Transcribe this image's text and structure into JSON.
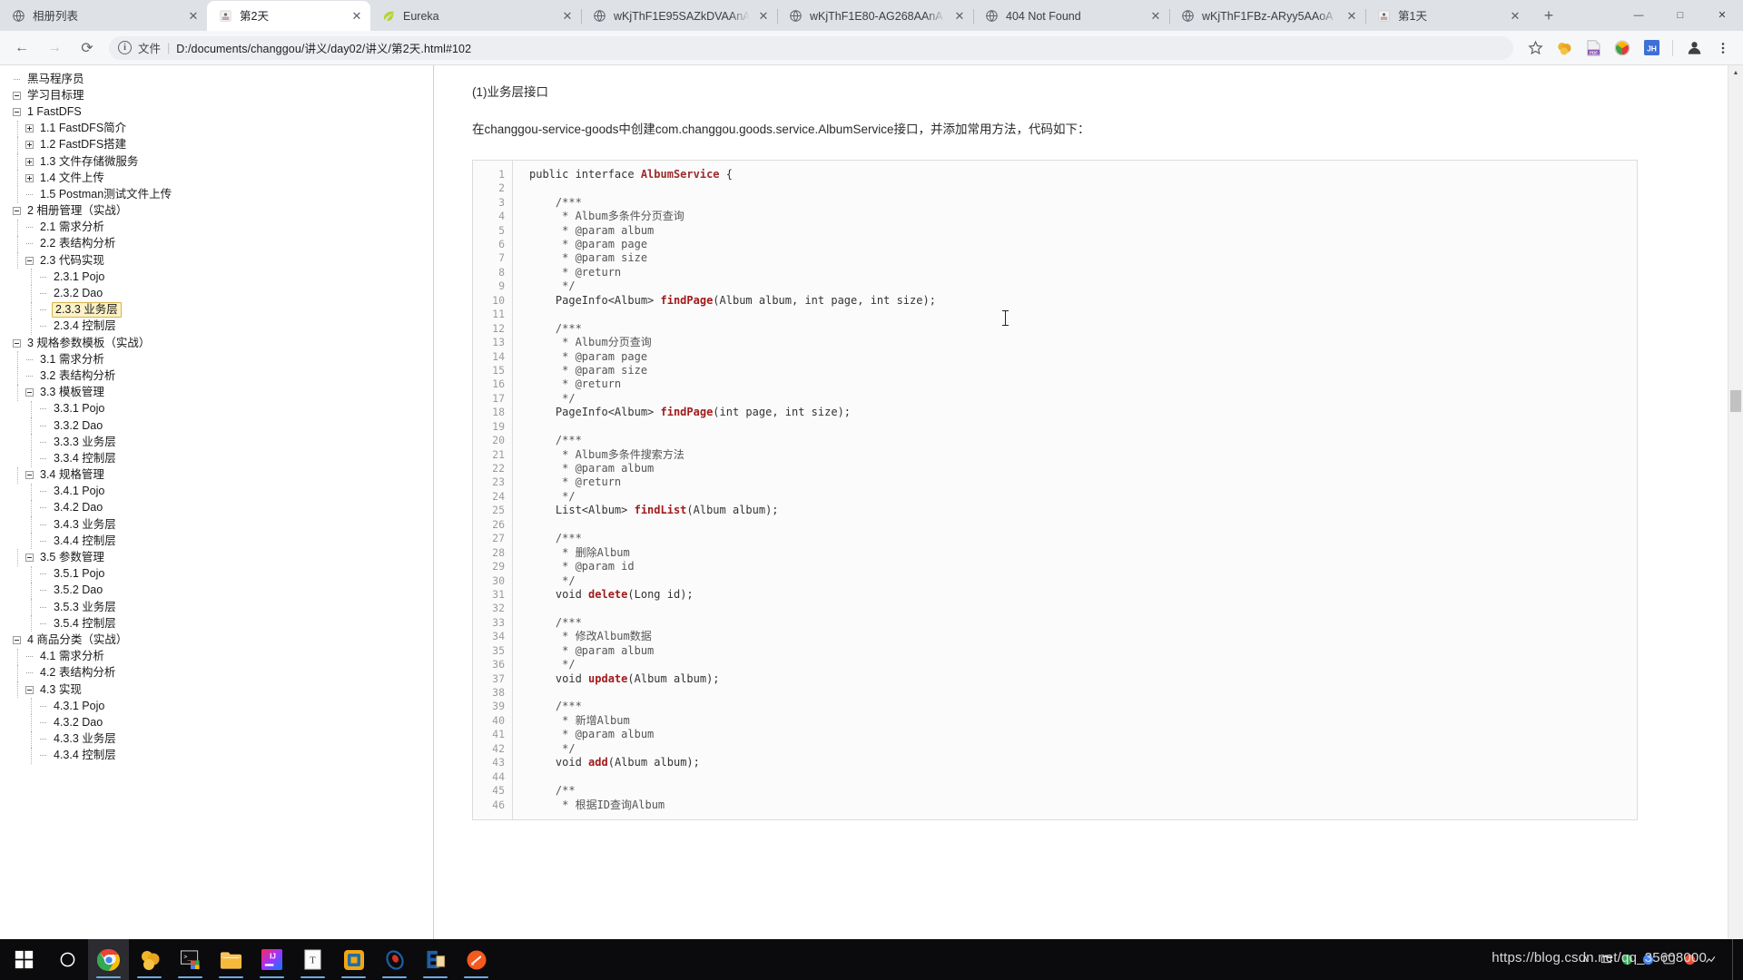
{
  "browser": {
    "tabs": [
      {
        "title": "相册列表",
        "icon": "globe-icon",
        "active": false
      },
      {
        "title": "第2天",
        "icon": "doc-icon",
        "active": true
      },
      {
        "title": "Eureka",
        "icon": "leaf-icon",
        "active": false
      },
      {
        "title": "wKjThF1E95SAZkDVAAnA",
        "icon": "globe-icon",
        "active": false
      },
      {
        "title": "wKjThF1E80-AG268AAnA",
        "icon": "globe-icon",
        "active": false
      },
      {
        "title": "404 Not Found",
        "icon": "globe-icon",
        "active": false
      },
      {
        "title": "wKjThF1FBz-ARyy5AAoA",
        "icon": "globe-icon",
        "active": false
      },
      {
        "title": "第1天",
        "icon": "doc-icon",
        "active": false
      }
    ],
    "new_tab_label": "+",
    "window_controls": {
      "minimize": "—",
      "maximize": "□",
      "close": "✕"
    },
    "close_label": "✕",
    "nav": {
      "back": "←",
      "forward": "→",
      "reload": "⟳"
    },
    "omnibox": {
      "info_glyph": "i",
      "scheme_label": "文件",
      "separator": "|",
      "url": "D:/documents/changgou/讲义/day02/讲义/第2天.html#102"
    },
    "toolbar_icons": [
      {
        "name": "bookmark-star-icon",
        "glyph": "☆"
      },
      {
        "name": "extension-honey-icon",
        "glyph": "●"
      },
      {
        "name": "pdf-extension-icon",
        "glyph": "PDF"
      },
      {
        "name": "yandex-extension-icon",
        "glyph": "①"
      },
      {
        "name": "jh-extension-icon",
        "glyph": "JH"
      },
      {
        "name": "profile-avatar-icon",
        "glyph": "●"
      },
      {
        "name": "chrome-menu-icon",
        "glyph": "⋮"
      }
    ]
  },
  "toc": {
    "items": [
      {
        "level": 0,
        "toggle": "none",
        "label": "黑马程序员",
        "highlight": false
      },
      {
        "level": 0,
        "toggle": "minus",
        "label": "学习目标理",
        "highlight": false
      },
      {
        "level": 1,
        "toggle": "minus",
        "label": "1 FastDFS",
        "highlight": false
      },
      {
        "level": 2,
        "toggle": "plus",
        "label": "1.1 FastDFS简介",
        "highlight": false
      },
      {
        "level": 2,
        "toggle": "plus",
        "label": "1.2 FastDFS搭建",
        "highlight": false
      },
      {
        "level": 2,
        "toggle": "plus",
        "label": "1.3 文件存储微服务",
        "highlight": false
      },
      {
        "level": 2,
        "toggle": "plus",
        "label": "1.4 文件上传",
        "highlight": false
      },
      {
        "level": 2,
        "toggle": "none",
        "label": "1.5 Postman测试文件上传",
        "highlight": false
      },
      {
        "level": 1,
        "toggle": "minus",
        "label": "2 相册管理（实战）",
        "highlight": false
      },
      {
        "level": 2,
        "toggle": "none",
        "label": "2.1 需求分析",
        "highlight": false
      },
      {
        "level": 2,
        "toggle": "none",
        "label": "2.2 表结构分析",
        "highlight": false
      },
      {
        "level": 2,
        "toggle": "minus",
        "label": "2.3 代码实现",
        "highlight": false
      },
      {
        "level": 3,
        "toggle": "none",
        "label": "2.3.1 Pojo",
        "highlight": false
      },
      {
        "level": 3,
        "toggle": "none",
        "label": "2.3.2 Dao",
        "highlight": false
      },
      {
        "level": 3,
        "toggle": "none",
        "label": "2.3.3 业务层",
        "highlight": true
      },
      {
        "level": 3,
        "toggle": "none",
        "label": "2.3.4 控制层",
        "highlight": false
      },
      {
        "level": 1,
        "toggle": "minus",
        "label": "3 规格参数模板（实战）",
        "highlight": false
      },
      {
        "level": 2,
        "toggle": "none",
        "label": "3.1 需求分析",
        "highlight": false
      },
      {
        "level": 2,
        "toggle": "none",
        "label": "3.2 表结构分析",
        "highlight": false
      },
      {
        "level": 2,
        "toggle": "minus",
        "label": "3.3 模板管理",
        "highlight": false
      },
      {
        "level": 3,
        "toggle": "none",
        "label": "3.3.1 Pojo",
        "highlight": false
      },
      {
        "level": 3,
        "toggle": "none",
        "label": "3.3.2 Dao",
        "highlight": false
      },
      {
        "level": 3,
        "toggle": "none",
        "label": "3.3.3 业务层",
        "highlight": false
      },
      {
        "level": 3,
        "toggle": "none",
        "label": "3.3.4 控制层",
        "highlight": false
      },
      {
        "level": 2,
        "toggle": "minus",
        "label": "3.4 规格管理",
        "highlight": false
      },
      {
        "level": 3,
        "toggle": "none",
        "label": "3.4.1 Pojo",
        "highlight": false
      },
      {
        "level": 3,
        "toggle": "none",
        "label": "3.4.2 Dao",
        "highlight": false
      },
      {
        "level": 3,
        "toggle": "none",
        "label": "3.4.3 业务层",
        "highlight": false
      },
      {
        "level": 3,
        "toggle": "none",
        "label": "3.4.4 控制层",
        "highlight": false
      },
      {
        "level": 2,
        "toggle": "minus",
        "label": "3.5 参数管理",
        "highlight": false
      },
      {
        "level": 3,
        "toggle": "none",
        "label": "3.5.1 Pojo",
        "highlight": false
      },
      {
        "level": 3,
        "toggle": "none",
        "label": "3.5.2 Dao",
        "highlight": false
      },
      {
        "level": 3,
        "toggle": "none",
        "label": "3.5.3 业务层",
        "highlight": false
      },
      {
        "level": 3,
        "toggle": "none",
        "label": "3.5.4 控制层",
        "highlight": false
      },
      {
        "level": 1,
        "toggle": "minus",
        "label": "4 商品分类（实战）",
        "highlight": false
      },
      {
        "level": 2,
        "toggle": "none",
        "label": "4.1 需求分析",
        "highlight": false
      },
      {
        "level": 2,
        "toggle": "none",
        "label": "4.2 表结构分析",
        "highlight": false
      },
      {
        "level": 2,
        "toggle": "minus",
        "label": "4.3 实现",
        "highlight": false
      },
      {
        "level": 3,
        "toggle": "none",
        "label": "4.3.1 Pojo",
        "highlight": false
      },
      {
        "level": 3,
        "toggle": "none",
        "label": "4.3.2 Dao",
        "highlight": false
      },
      {
        "level": 3,
        "toggle": "none",
        "label": "4.3.3 业务层",
        "highlight": false
      },
      {
        "level": 3,
        "toggle": "none",
        "label": "4.3.4 控制层",
        "highlight": false
      }
    ]
  },
  "content": {
    "heading": "(1)业务层接口",
    "intro": "在changgou-service-goods中创建com.changgou.goods.service.AlbumService接口，并添加常用方法，代码如下：",
    "code_lines": [
      {
        "n": 1,
        "tokens": [
          {
            "t": "public interface ",
            "c": "k"
          },
          {
            "t": "AlbumService",
            "c": "cn"
          },
          {
            "t": " {",
            "c": "k"
          }
        ]
      },
      {
        "n": 2,
        "tokens": []
      },
      {
        "n": 3,
        "tokens": [
          {
            "t": "    /***",
            "c": "cm"
          }
        ]
      },
      {
        "n": 4,
        "tokens": [
          {
            "t": "     * Album多条件分页查询",
            "c": "cm"
          }
        ]
      },
      {
        "n": 5,
        "tokens": [
          {
            "t": "     * @param album",
            "c": "cm"
          }
        ]
      },
      {
        "n": 6,
        "tokens": [
          {
            "t": "     * @param page",
            "c": "cm"
          }
        ]
      },
      {
        "n": 7,
        "tokens": [
          {
            "t": "     * @param size",
            "c": "cm"
          }
        ]
      },
      {
        "n": 8,
        "tokens": [
          {
            "t": "     * @return",
            "c": "cm"
          }
        ]
      },
      {
        "n": 9,
        "tokens": [
          {
            "t": "     */",
            "c": "cm"
          }
        ]
      },
      {
        "n": 10,
        "tokens": [
          {
            "t": "    PageInfo<Album> ",
            "c": "k"
          },
          {
            "t": "findPage",
            "c": "fn"
          },
          {
            "t": "(Album album, int page, int size);",
            "c": "pn"
          }
        ]
      },
      {
        "n": 11,
        "tokens": []
      },
      {
        "n": 12,
        "tokens": [
          {
            "t": "    /***",
            "c": "cm"
          }
        ]
      },
      {
        "n": 13,
        "tokens": [
          {
            "t": "     * Album分页查询",
            "c": "cm"
          }
        ]
      },
      {
        "n": 14,
        "tokens": [
          {
            "t": "     * @param page",
            "c": "cm"
          }
        ]
      },
      {
        "n": 15,
        "tokens": [
          {
            "t": "     * @param size",
            "c": "cm"
          }
        ]
      },
      {
        "n": 16,
        "tokens": [
          {
            "t": "     * @return",
            "c": "cm"
          }
        ]
      },
      {
        "n": 17,
        "tokens": [
          {
            "t": "     */",
            "c": "cm"
          }
        ]
      },
      {
        "n": 18,
        "tokens": [
          {
            "t": "    PageInfo<Album> ",
            "c": "k"
          },
          {
            "t": "findPage",
            "c": "fn"
          },
          {
            "t": "(int page, int size);",
            "c": "pn"
          }
        ]
      },
      {
        "n": 19,
        "tokens": []
      },
      {
        "n": 20,
        "tokens": [
          {
            "t": "    /***",
            "c": "cm"
          }
        ]
      },
      {
        "n": 21,
        "tokens": [
          {
            "t": "     * Album多条件搜索方法",
            "c": "cm"
          }
        ]
      },
      {
        "n": 22,
        "tokens": [
          {
            "t": "     * @param album",
            "c": "cm"
          }
        ]
      },
      {
        "n": 23,
        "tokens": [
          {
            "t": "     * @return",
            "c": "cm"
          }
        ]
      },
      {
        "n": 24,
        "tokens": [
          {
            "t": "     */",
            "c": "cm"
          }
        ]
      },
      {
        "n": 25,
        "tokens": [
          {
            "t": "    List<Album> ",
            "c": "k"
          },
          {
            "t": "findList",
            "c": "fn"
          },
          {
            "t": "(Album album);",
            "c": "pn"
          }
        ]
      },
      {
        "n": 26,
        "tokens": []
      },
      {
        "n": 27,
        "tokens": [
          {
            "t": "    /***",
            "c": "cm"
          }
        ]
      },
      {
        "n": 28,
        "tokens": [
          {
            "t": "     * 删除Album",
            "c": "cm"
          }
        ]
      },
      {
        "n": 29,
        "tokens": [
          {
            "t": "     * @param id",
            "c": "cm"
          }
        ]
      },
      {
        "n": 30,
        "tokens": [
          {
            "t": "     */",
            "c": "cm"
          }
        ]
      },
      {
        "n": 31,
        "tokens": [
          {
            "t": "    void ",
            "c": "k"
          },
          {
            "t": "delete",
            "c": "fn"
          },
          {
            "t": "(Long id);",
            "c": "pn"
          }
        ]
      },
      {
        "n": 32,
        "tokens": []
      },
      {
        "n": 33,
        "tokens": [
          {
            "t": "    /***",
            "c": "cm"
          }
        ]
      },
      {
        "n": 34,
        "tokens": [
          {
            "t": "     * 修改Album数据",
            "c": "cm"
          }
        ]
      },
      {
        "n": 35,
        "tokens": [
          {
            "t": "     * @param album",
            "c": "cm"
          }
        ]
      },
      {
        "n": 36,
        "tokens": [
          {
            "t": "     */",
            "c": "cm"
          }
        ]
      },
      {
        "n": 37,
        "tokens": [
          {
            "t": "    void ",
            "c": "k"
          },
          {
            "t": "update",
            "c": "fn"
          },
          {
            "t": "(Album album);",
            "c": "pn"
          }
        ]
      },
      {
        "n": 38,
        "tokens": []
      },
      {
        "n": 39,
        "tokens": [
          {
            "t": "    /***",
            "c": "cm"
          }
        ]
      },
      {
        "n": 40,
        "tokens": [
          {
            "t": "     * 新增Album",
            "c": "cm"
          }
        ]
      },
      {
        "n": 41,
        "tokens": [
          {
            "t": "     * @param album",
            "c": "cm"
          }
        ]
      },
      {
        "n": 42,
        "tokens": [
          {
            "t": "     */",
            "c": "cm"
          }
        ]
      },
      {
        "n": 43,
        "tokens": [
          {
            "t": "    void ",
            "c": "k"
          },
          {
            "t": "add",
            "c": "fn"
          },
          {
            "t": "(Album album);",
            "c": "pn"
          }
        ]
      },
      {
        "n": 44,
        "tokens": []
      },
      {
        "n": 45,
        "tokens": [
          {
            "t": "    /**",
            "c": "cm"
          }
        ]
      },
      {
        "n": 46,
        "tokens": [
          {
            "t": "     * 根据ID查询Album",
            "c": "cm"
          }
        ]
      }
    ]
  },
  "scrollbar": {
    "up_glyph": "▲",
    "down_glyph": "▼"
  },
  "taskbar": {
    "items": [
      {
        "name": "start-button",
        "glyph": "⊞",
        "running": false,
        "active": false
      },
      {
        "name": "cortana-search-icon",
        "glyph": "○",
        "running": false,
        "active": false
      },
      {
        "name": "chrome-icon",
        "glyph": "◉",
        "running": true,
        "active": true
      },
      {
        "name": "navicat-icon",
        "glyph": "●",
        "running": true,
        "active": false
      },
      {
        "name": "terminal-icon",
        "glyph": "▣",
        "running": true,
        "active": false
      },
      {
        "name": "file-explorer-icon",
        "glyph": "▬",
        "running": true,
        "active": false
      },
      {
        "name": "intellij-idea-icon",
        "glyph": "IJ",
        "running": true,
        "active": false
      },
      {
        "name": "typora-icon",
        "glyph": "T",
        "running": true,
        "active": false
      },
      {
        "name": "vmware-icon",
        "glyph": "□",
        "running": true,
        "active": false
      },
      {
        "name": "postman-icon",
        "glyph": "◑",
        "running": true,
        "active": false
      },
      {
        "name": "editplus-icon",
        "glyph": "E",
        "running": true,
        "active": false
      },
      {
        "name": "xmind-icon",
        "glyph": "✒",
        "running": true,
        "active": false
      }
    ],
    "tray": {
      "overflow_glyph": "∧",
      "watermark": "https://blog.csdn.net/qq_35608000"
    }
  }
}
